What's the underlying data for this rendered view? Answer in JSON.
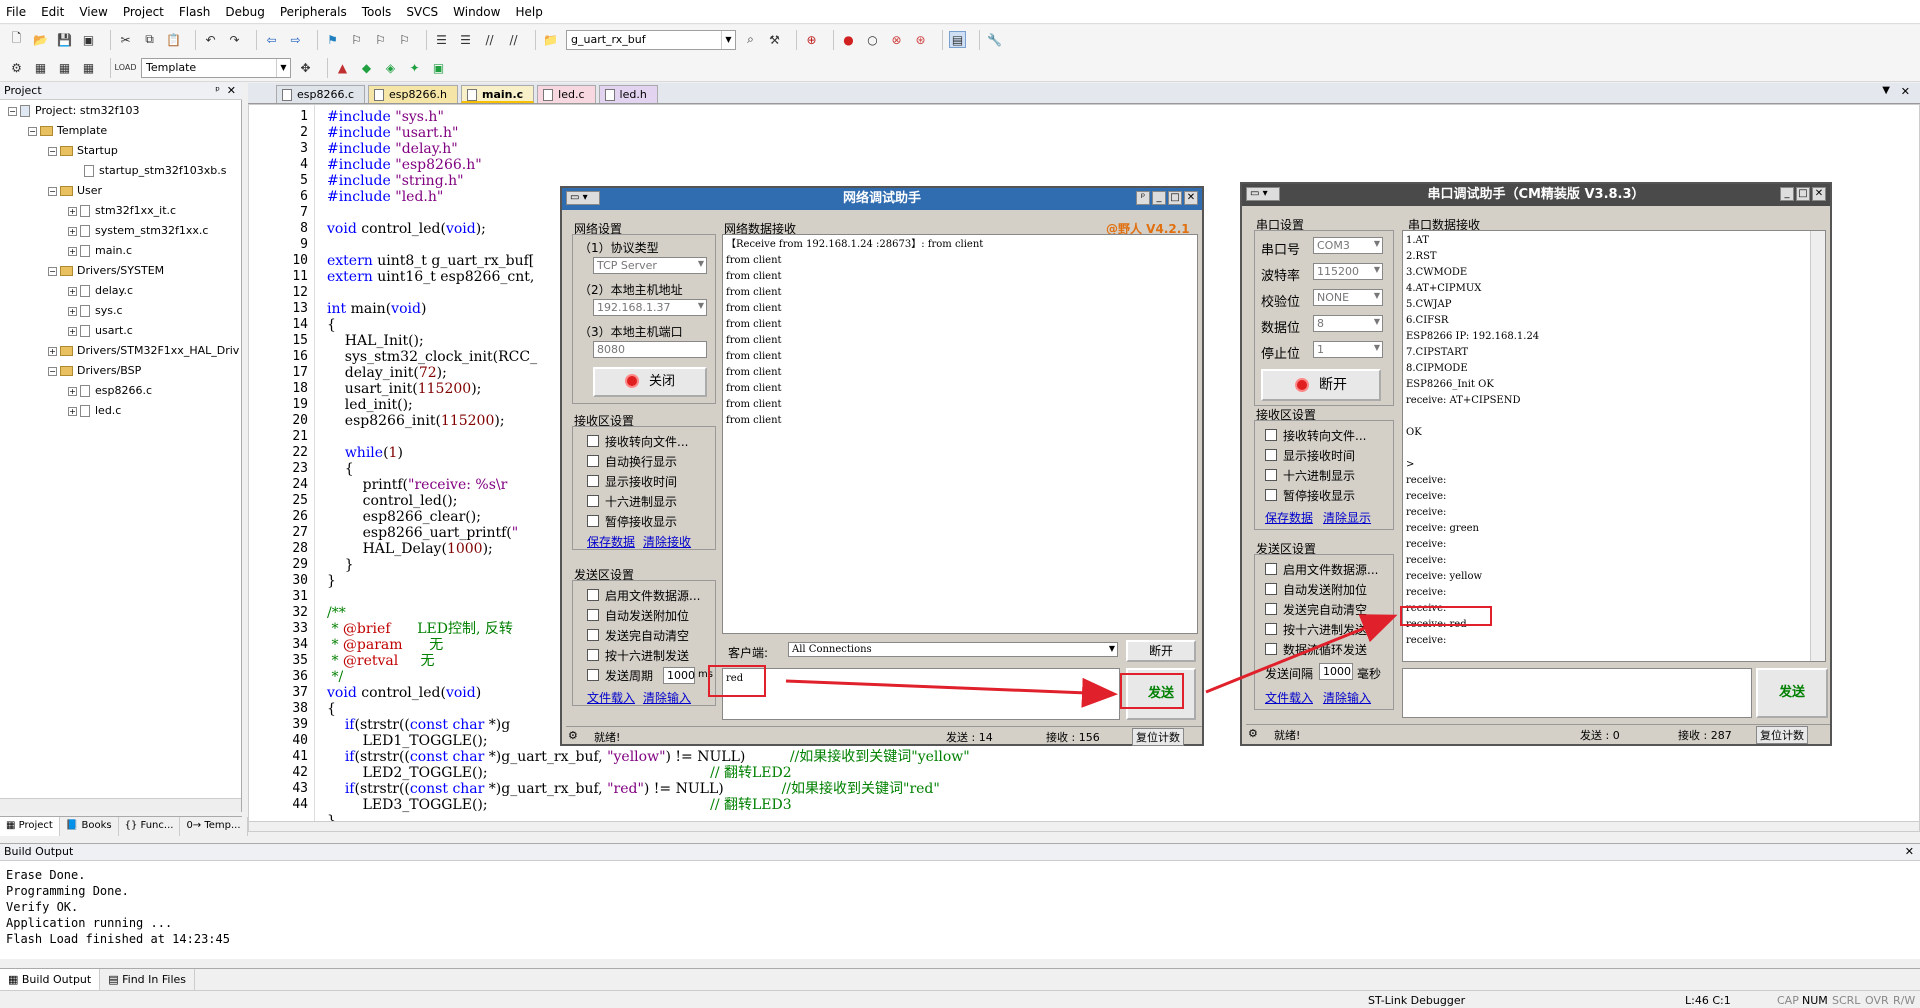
{
  "menu": [
    "File",
    "Edit",
    "View",
    "Project",
    "Flash",
    "Debug",
    "Peripherals",
    "Tools",
    "SVCS",
    "Window",
    "Help"
  ],
  "toolbar": {
    "target_combo": "g_uart_rx_buf",
    "project_combo": "Template"
  },
  "project_panel": {
    "title": "Project",
    "tree": [
      {
        "label": "Project: stm32f103",
        "level": 0,
        "type": "root"
      },
      {
        "label": "Template",
        "level": 1,
        "type": "folder"
      },
      {
        "label": "Startup",
        "level": 2,
        "type": "folder"
      },
      {
        "label": "startup_stm32f103xb.s",
        "level": 3,
        "type": "file"
      },
      {
        "label": "User",
        "level": 2,
        "type": "folder"
      },
      {
        "label": "stm32f1xx_it.c",
        "level": 3,
        "type": "file"
      },
      {
        "label": "system_stm32f1xx.c",
        "level": 3,
        "type": "file"
      },
      {
        "label": "main.c",
        "level": 3,
        "type": "file"
      },
      {
        "label": "Drivers/SYSTEM",
        "level": 2,
        "type": "folder"
      },
      {
        "label": "delay.c",
        "level": 3,
        "type": "file"
      },
      {
        "label": "sys.c",
        "level": 3,
        "type": "file"
      },
      {
        "label": "usart.c",
        "level": 3,
        "type": "file"
      },
      {
        "label": "Drivers/STM32F1xx_HAL_Driv",
        "level": 2,
        "type": "folder"
      },
      {
        "label": "Drivers/BSP",
        "level": 2,
        "type": "folder"
      },
      {
        "label": "esp8266.c",
        "level": 3,
        "type": "file"
      },
      {
        "label": "led.c",
        "level": 3,
        "type": "file"
      }
    ],
    "tabs": [
      "Project",
      "Books",
      "{} Func...",
      "0→ Temp..."
    ]
  },
  "editor_tabs": [
    {
      "label": "esp8266.c",
      "color": "#dfe3ea"
    },
    {
      "label": "esp8266.h",
      "color": "#f5e6a8"
    },
    {
      "label": "main.c",
      "color": "#f7f0c8"
    },
    {
      "label": "led.c",
      "color": "#f7d8e0"
    },
    {
      "label": "led.h",
      "color": "#e2d4f0"
    }
  ],
  "line_numbers": [
    "1",
    "2",
    "3",
    "4",
    "5",
    "6",
    "7",
    "8",
    "9",
    "10",
    "11",
    "12",
    "13",
    "14",
    "15",
    "16",
    "17",
    "18",
    "19",
    "20",
    "21",
    "22",
    "23",
    "24",
    "25",
    "26",
    "27",
    "28",
    "29",
    "30",
    "31",
    "32",
    "33",
    "34",
    "35",
    "36",
    "37",
    "38",
    "39",
    "40",
    "41",
    "42",
    "43",
    "44"
  ],
  "build_output": {
    "title": "Build Output",
    "text": "Erase Done.\nProgramming Done.\nVerify OK.\nApplication running ...\nFlash Load finished at 14:23:45",
    "tabs": [
      "Build Output",
      "Find In Files"
    ]
  },
  "status": {
    "debugger": "ST-Link Debugger",
    "pos": "L:46 C:1",
    "flags": [
      "CAP",
      "NUM",
      "SCRL",
      "OVR",
      "R/W"
    ]
  },
  "net": {
    "title": "网络调试助手",
    "ver": "@野人 V4.2.1",
    "settings_label": "网络设置",
    "proto_label": "（1）协议类型",
    "proto_val": "TCP Server",
    "ip_label": "（2）本地主机地址",
    "ip_val": "192.168.1.37",
    "port_label": "（3）本地主机端口",
    "port_val": "8080",
    "close_btn": "关闭",
    "recv_label": "接收区设置",
    "recv_opts": [
      "接收转向文件...",
      "自动换行显示",
      "显示接收时间",
      "十六进制显示",
      "暂停接收显示"
    ],
    "save_data": "保存数据",
    "clear_recv": "清除接收",
    "send_label": "发送区设置",
    "send_opts": [
      "启用文件数据源...",
      "自动发送附加位",
      "发送完自动清空",
      "按十六进制发送"
    ],
    "period_label": "发送周期",
    "period_val": "1000",
    "period_unit": "ms",
    "load_file": "文件载入",
    "clear_input": "清除输入",
    "data_recv_label": "网络数据接收",
    "recv_text": "【Receive from 192.168.1.24 :28673】: from client\nfrom client\nfrom client\nfrom client\nfrom client\nfrom client\nfrom client\nfrom client\nfrom client\nfrom client\nfrom client\nfrom client",
    "client_label": "客户端:",
    "client_val": "All Connections",
    "disconnect_btn": "断开",
    "send_text": "red",
    "send_btn": "发送",
    "status_ready": "就绪!",
    "sent": "发送 : 14",
    "recvd": "接收 : 156",
    "reset_btn": "复位计数"
  },
  "serial": {
    "title": "串口调试助手（CM精装版 V3.8.3）",
    "settings_label": "串口设置",
    "port_label": "串口号",
    "port_val": "COM3",
    "baud_label": "波特率",
    "baud_val": "115200",
    "parity_label": "校验位",
    "parity_val": "NONE",
    "data_label": "数据位",
    "data_val": "8",
    "stop_label": "停止位",
    "stop_val": "1",
    "open_btn": "断开",
    "recv_label": "接收区设置",
    "recv_opts": [
      "接收转向文件...",
      "显示接收时间",
      "十六进制显示",
      "暂停接收显示"
    ],
    "save_data": "保存数据",
    "clear_show": "清除显示",
    "send_label": "发送区设置",
    "send_opts": [
      "启用文件数据源...",
      "自动发送附加位",
      "发送完自动清空",
      "按十六进制发送",
      "数据流循环发送"
    ],
    "interval_label": "发送间隔",
    "interval_val": "1000",
    "interval_unit": "毫秒",
    "load_file": "文件载入",
    "clear_input": "清除输入",
    "data_recv_label": "串口数据接收",
    "recv_text": "1.AT\n2.RST\n3.CWMODE\n4.AT+CIPMUX\n5.CWJAP\n6.CIFSR\nESP8266 IP: 192.168.1.24\n7.CIPSTART\n8.CIPMODE\nESP8266_Init OK\nreceive: AT+CIPSEND\n\nOK\n\n>\nreceive:\nreceive:\nreceive:\nreceive: green\nreceive:\nreceive:\nreceive: yellow\nreceive:\nreceive:\nreceive: red\nreceive:",
    "send_btn": "发送",
    "status_ready": "就绪!",
    "sent": "发送 : 0",
    "recvd": "接收 : 287",
    "reset_btn": "复位计数"
  }
}
